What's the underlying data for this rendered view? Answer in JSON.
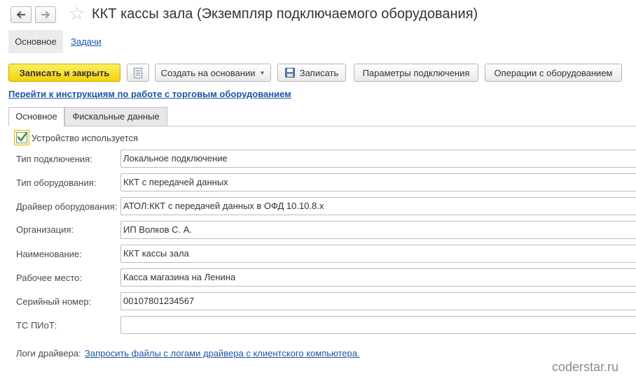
{
  "window": {
    "title": "ККТ кассы зала (Экземпляр подключаемого оборудования)"
  },
  "subtabs": [
    {
      "label": "Основное"
    },
    {
      "label": "Задачи"
    }
  ],
  "toolbar": {
    "save_close_label": "Записать и закрыть",
    "create_based_label": "Создать на основании",
    "save_label": "Записать",
    "connection_params_label": "Параметры подключения",
    "equipment_ops_label": "Операции с оборудованием"
  },
  "help_link": "Перейти к инструкциям по работе с торговым оборудованием",
  "tabs": [
    {
      "label": "Основное"
    },
    {
      "label": "Фискальные данные"
    }
  ],
  "device_used": {
    "label": "Устройство используется",
    "checked": true
  },
  "fields": [
    {
      "label": "Тип подключения:",
      "value": "Локальное подключение"
    },
    {
      "label": "Тип оборудования:",
      "value": "ККТ с передачей данных"
    },
    {
      "label": "Драйвер оборудования:",
      "value": "АТОЛ:ККТ с передачей данных в ОФД 10.10.8.x"
    },
    {
      "label": "Организация:",
      "value": "ИП Волков С. А."
    },
    {
      "label": "Наименование:",
      "value": "ККТ кассы зала"
    },
    {
      "label": "Рабочее место:",
      "value": "Касса магазина на Ленина"
    },
    {
      "label": "Серийный номер:",
      "value": "00107801234567"
    },
    {
      "label": "ТС ПИоТ:",
      "value": ""
    }
  ],
  "driver_logs": {
    "label": "Логи драйвера:",
    "link": "Запросить файлы с логами драйвера с клиентского компьютера."
  },
  "watermark": "coderstar.ru",
  "icons": {
    "back": "arrow-left-icon",
    "forward": "arrow-right-icon",
    "favorite": "star-icon",
    "list": "list-icon",
    "save": "floppy-disk-icon",
    "dropdown": "caret-down-icon",
    "check": "checkmark-icon"
  },
  "colors": {
    "primary_button": "#f2d30a",
    "link": "#1a55a8",
    "check": "#2e9e2e"
  }
}
